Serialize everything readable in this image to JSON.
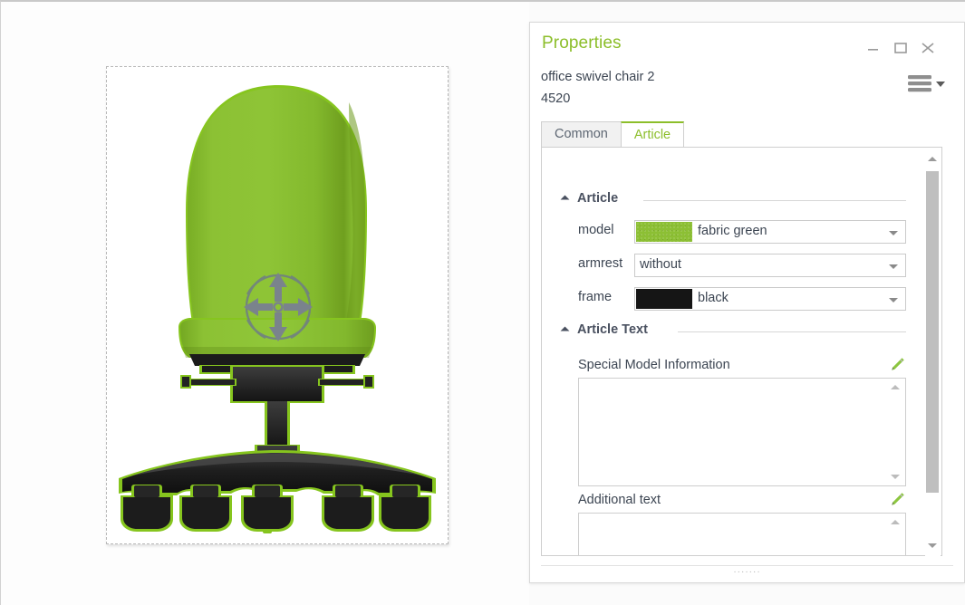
{
  "window": {
    "title": "Properties",
    "object_name": "office swivel chair 2",
    "object_id": "4520",
    "accent_color": "#8cbe2a",
    "controls": {
      "minimize": "minimize-icon",
      "maximize": "maximize-icon",
      "close": "close-icon",
      "menu": "hamburger-menu-icon"
    },
    "grip": "·······"
  },
  "tabs": [
    {
      "label": "Common",
      "active": false
    },
    {
      "label": "Article",
      "active": true
    }
  ],
  "sections": {
    "article": {
      "title": "Article",
      "fields": [
        {
          "label": "model",
          "value": "fabric green",
          "swatch": "fabric",
          "swatch_color": "#8cbf34"
        },
        {
          "label": "armrest",
          "value": "without",
          "swatch": "none",
          "swatch_color": ""
        },
        {
          "label": "frame",
          "value": "black",
          "swatch": "solid",
          "swatch_color": "#151515"
        }
      ]
    },
    "article_text": {
      "title": "Article Text",
      "blocks": [
        {
          "label": "Special Model Information",
          "value": "",
          "edit_icon": "pencil-icon"
        },
        {
          "label": "Additional text",
          "value": "",
          "edit_icon": "pencil-icon"
        }
      ]
    }
  },
  "canvas": {
    "selection": "dashed-selection-frame",
    "gizmo": "move-gizmo-icon",
    "chair": {
      "upholstery_color": "#84bc2e",
      "frame_color": "#1b1b1b",
      "highlight_color": "#86c51e",
      "wheel_count": 5
    }
  }
}
